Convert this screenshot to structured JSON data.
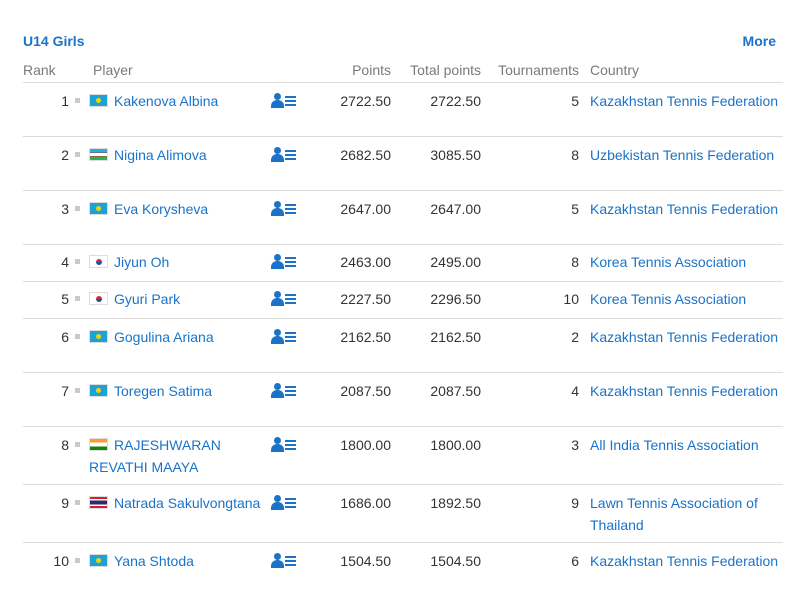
{
  "header": {
    "title": "U14 Girls",
    "more_label": "More"
  },
  "columns": {
    "rank": "Rank",
    "player": "Player",
    "points": "Points",
    "total_points": "Total points",
    "tournaments": "Tournaments",
    "country": "Country"
  },
  "rows": [
    {
      "rank": "1",
      "flag": "kz",
      "player": "Kakenova Albina",
      "points": "2722.50",
      "total": "2722.50",
      "tournaments": "5",
      "country": "Kazakhstan Tennis Federation"
    },
    {
      "rank": "2",
      "flag": "uz",
      "player": "Nigina Alimova",
      "points": "2682.50",
      "total": "3085.50",
      "tournaments": "8",
      "country": "Uzbekistan Tennis Federation"
    },
    {
      "rank": "3",
      "flag": "kz",
      "player": "Eva Korysheva",
      "points": "2647.00",
      "total": "2647.00",
      "tournaments": "5",
      "country": "Kazakhstan Tennis Federation"
    },
    {
      "rank": "4",
      "flag": "kr",
      "player": "Jiyun Oh",
      "points": "2463.00",
      "total": "2495.00",
      "tournaments": "8",
      "country": "Korea Tennis Association"
    },
    {
      "rank": "5",
      "flag": "kr",
      "player": "Gyuri Park",
      "points": "2227.50",
      "total": "2296.50",
      "tournaments": "10",
      "country": "Korea Tennis Association"
    },
    {
      "rank": "6",
      "flag": "kz",
      "player": "Gogulina Ariana",
      "points": "2162.50",
      "total": "2162.50",
      "tournaments": "2",
      "country": "Kazakhstan Tennis Federation"
    },
    {
      "rank": "7",
      "flag": "kz",
      "player": "Toregen Satima",
      "points": "2087.50",
      "total": "2087.50",
      "tournaments": "4",
      "country": "Kazakhstan Tennis Federation"
    },
    {
      "rank": "8",
      "flag": "in",
      "player": "RAJESHWARAN REVATHI MAAYA",
      "points": "1800.00",
      "total": "1800.00",
      "tournaments": "3",
      "country": "All India Tennis Association"
    },
    {
      "rank": "9",
      "flag": "th",
      "player": "Natrada Sakulvongtana",
      "points": "1686.00",
      "total": "1892.50",
      "tournaments": "9",
      "country": "Lawn Tennis Association of Thailand"
    },
    {
      "rank": "10",
      "flag": "kz",
      "player": "Yana Shtoda",
      "points": "1504.50",
      "total": "1504.50",
      "tournaments": "6",
      "country": "Kazakhstan Tennis Federation"
    }
  ],
  "icons": {
    "player_profile": "player-profile-icon",
    "rank_movement": "rank-unchanged-icon"
  },
  "colors": {
    "link": "#1a73c9",
    "header_text": "#7a7a7a",
    "divider": "#dcdcdc"
  }
}
